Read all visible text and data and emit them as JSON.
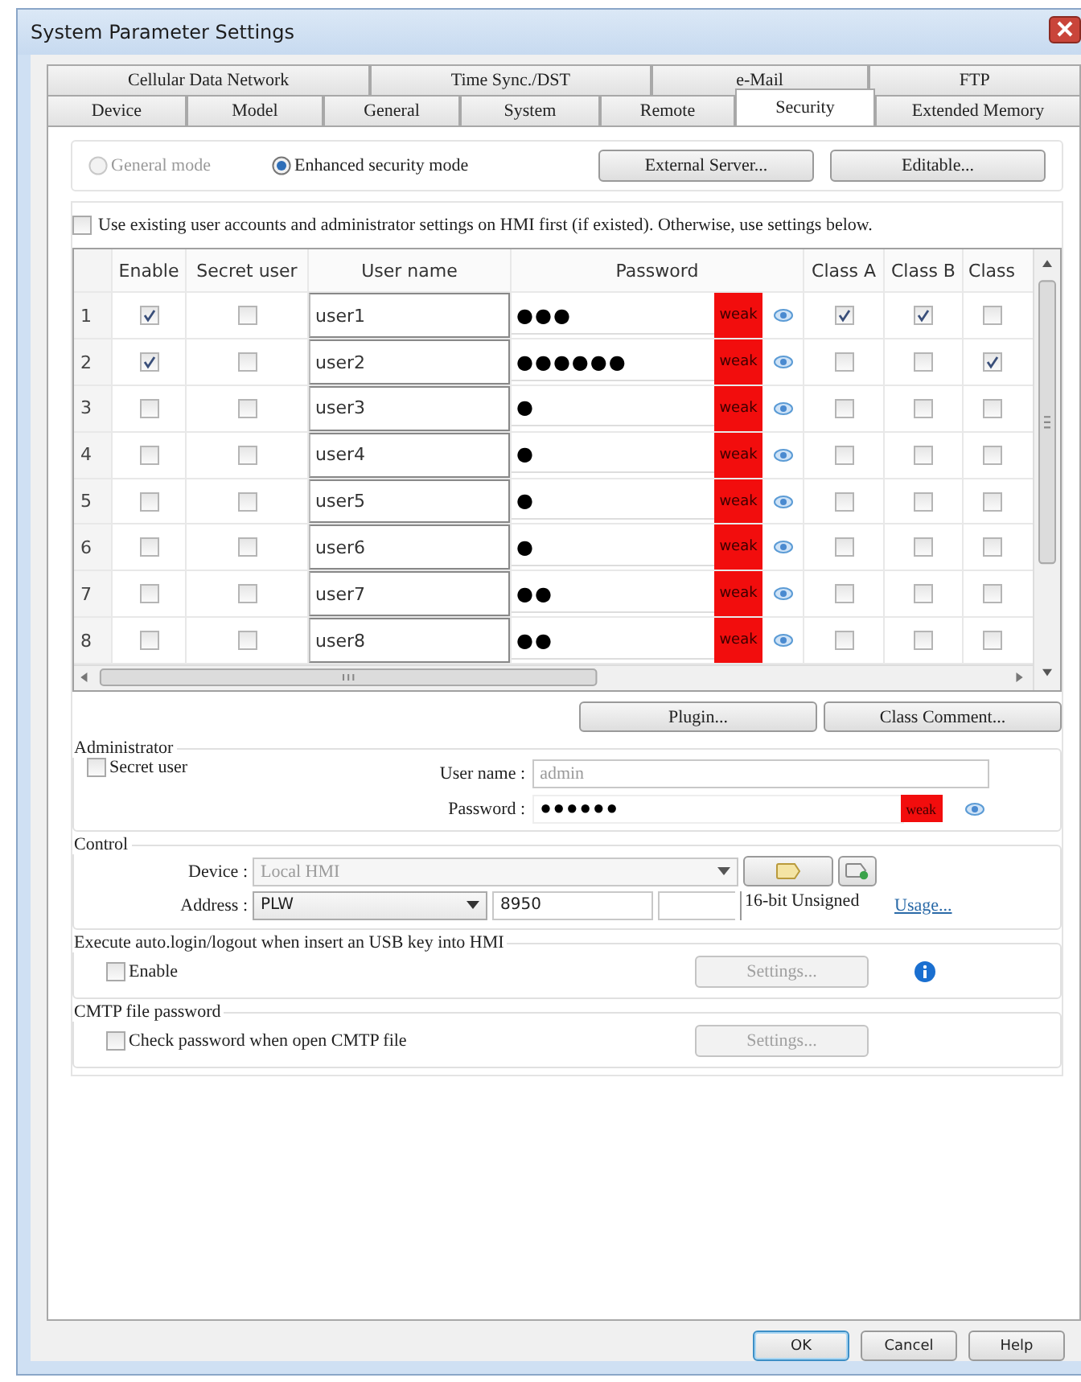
{
  "window": {
    "title": "System Parameter Settings"
  },
  "tabs_top": [
    {
      "label": "Cellular Data Network",
      "selected": false
    },
    {
      "label": "Time Sync./DST",
      "selected": false
    },
    {
      "label": "e-Mail",
      "selected": false
    },
    {
      "label": "FTP",
      "selected": false
    }
  ],
  "tabs_bottom": [
    {
      "label": "Device",
      "selected": false
    },
    {
      "label": "Model",
      "selected": false
    },
    {
      "label": "General",
      "selected": false
    },
    {
      "label": "System",
      "selected": false
    },
    {
      "label": "Remote",
      "selected": false
    },
    {
      "label": "Security",
      "selected": true
    },
    {
      "label": "Extended Memory",
      "selected": false
    }
  ],
  "modes": [
    {
      "label": "General mode",
      "selected": false,
      "disabled": true
    },
    {
      "label": "Enhanced security mode",
      "selected": true,
      "disabled": false
    }
  ],
  "mode_buttons": [
    "External Server...",
    "Editable..."
  ],
  "use_existing": {
    "label": "Use existing user accounts and administrator settings on HMI first (if existed). Otherwise, use settings below.",
    "checked": false
  },
  "table": {
    "columns": [
      "Enable",
      "Secret user",
      "User name",
      "Password",
      "Class A",
      "Class B",
      "Class"
    ],
    "rows": [
      {
        "index": "1",
        "enable": true,
        "secret_user": false,
        "user_name": "user1",
        "password": "●●●",
        "strength": "weak",
        "classes": [
          true,
          true,
          false
        ]
      },
      {
        "index": "2",
        "enable": true,
        "secret_user": false,
        "user_name": "user2",
        "password": "●●●●●●",
        "strength": "weak",
        "classes": [
          false,
          false,
          true
        ]
      },
      {
        "index": "3",
        "enable": false,
        "secret_user": false,
        "user_name": "user3",
        "password": "●",
        "strength": "weak",
        "classes": [
          false,
          false,
          false
        ]
      },
      {
        "index": "4",
        "enable": false,
        "secret_user": false,
        "user_name": "user4",
        "password": "●",
        "strength": "weak",
        "classes": [
          false,
          false,
          false
        ]
      },
      {
        "index": "5",
        "enable": false,
        "secret_user": false,
        "user_name": "user5",
        "password": "●",
        "strength": "weak",
        "classes": [
          false,
          false,
          false
        ]
      },
      {
        "index": "6",
        "enable": false,
        "secret_user": false,
        "user_name": "user6",
        "password": "●",
        "strength": "weak",
        "classes": [
          false,
          false,
          false
        ]
      },
      {
        "index": "7",
        "enable": false,
        "secret_user": false,
        "user_name": "user7",
        "password": "●●",
        "strength": "weak",
        "classes": [
          false,
          false,
          false
        ]
      },
      {
        "index": "8",
        "enable": false,
        "secret_user": false,
        "user_name": "user8",
        "password": "●●",
        "strength": "weak",
        "classes": [
          false,
          false,
          false
        ]
      }
    ]
  },
  "table_buttons": [
    "Plugin...",
    "Class Comment..."
  ],
  "administrator": {
    "title": "Administrator",
    "secret_user": {
      "label": "Secret user",
      "checked": false
    },
    "user_name_label": "User name :",
    "user_name": "admin",
    "user_name_disabled": true,
    "password_label": "Password :",
    "password": "●●●●●●",
    "strength": "weak"
  },
  "control": {
    "title": "Control",
    "device_label": "Device :",
    "device": "Local HMI",
    "device_disabled": true,
    "address_label": "Address :",
    "address_type": "PLW",
    "address": "8950",
    "data_format": "16-bit Unsigned",
    "usage_link": "Usage..."
  },
  "usb": {
    "title": "Execute auto.login/logout when insert an USB key into HMI",
    "enable": {
      "label": "Enable",
      "checked": false
    },
    "settings_button": "Settings...",
    "settings_disabled": true
  },
  "cmtp": {
    "title": "CMTP file password",
    "check": {
      "label": "Check password when open CMTP file",
      "checked": false
    },
    "settings_button": "Settings...",
    "settings_disabled": true
  },
  "footer_buttons": [
    "OK",
    "Cancel",
    "Help"
  ]
}
